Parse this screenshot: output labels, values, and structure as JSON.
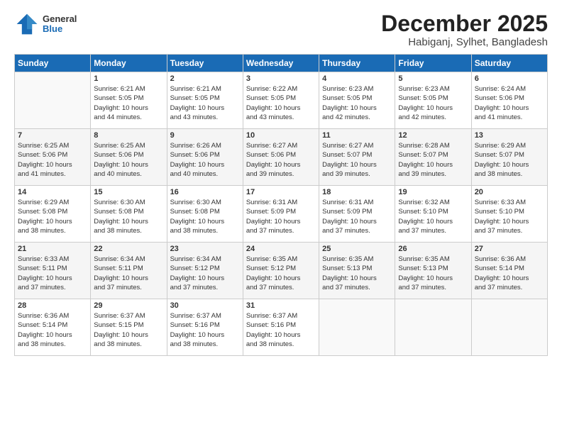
{
  "header": {
    "logo_general": "General",
    "logo_blue": "Blue",
    "month": "December 2025",
    "location": "Habiganj, Sylhet, Bangladesh"
  },
  "weekdays": [
    "Sunday",
    "Monday",
    "Tuesday",
    "Wednesday",
    "Thursday",
    "Friday",
    "Saturday"
  ],
  "weeks": [
    [
      {
        "day": "",
        "content": ""
      },
      {
        "day": "1",
        "content": "Sunrise: 6:21 AM\nSunset: 5:05 PM\nDaylight: 10 hours\nand 44 minutes."
      },
      {
        "day": "2",
        "content": "Sunrise: 6:21 AM\nSunset: 5:05 PM\nDaylight: 10 hours\nand 43 minutes."
      },
      {
        "day": "3",
        "content": "Sunrise: 6:22 AM\nSunset: 5:05 PM\nDaylight: 10 hours\nand 43 minutes."
      },
      {
        "day": "4",
        "content": "Sunrise: 6:23 AM\nSunset: 5:05 PM\nDaylight: 10 hours\nand 42 minutes."
      },
      {
        "day": "5",
        "content": "Sunrise: 6:23 AM\nSunset: 5:05 PM\nDaylight: 10 hours\nand 42 minutes."
      },
      {
        "day": "6",
        "content": "Sunrise: 6:24 AM\nSunset: 5:06 PM\nDaylight: 10 hours\nand 41 minutes."
      }
    ],
    [
      {
        "day": "7",
        "content": "Sunrise: 6:25 AM\nSunset: 5:06 PM\nDaylight: 10 hours\nand 41 minutes."
      },
      {
        "day": "8",
        "content": "Sunrise: 6:25 AM\nSunset: 5:06 PM\nDaylight: 10 hours\nand 40 minutes."
      },
      {
        "day": "9",
        "content": "Sunrise: 6:26 AM\nSunset: 5:06 PM\nDaylight: 10 hours\nand 40 minutes."
      },
      {
        "day": "10",
        "content": "Sunrise: 6:27 AM\nSunset: 5:06 PM\nDaylight: 10 hours\nand 39 minutes."
      },
      {
        "day": "11",
        "content": "Sunrise: 6:27 AM\nSunset: 5:07 PM\nDaylight: 10 hours\nand 39 minutes."
      },
      {
        "day": "12",
        "content": "Sunrise: 6:28 AM\nSunset: 5:07 PM\nDaylight: 10 hours\nand 39 minutes."
      },
      {
        "day": "13",
        "content": "Sunrise: 6:29 AM\nSunset: 5:07 PM\nDaylight: 10 hours\nand 38 minutes."
      }
    ],
    [
      {
        "day": "14",
        "content": "Sunrise: 6:29 AM\nSunset: 5:08 PM\nDaylight: 10 hours\nand 38 minutes."
      },
      {
        "day": "15",
        "content": "Sunrise: 6:30 AM\nSunset: 5:08 PM\nDaylight: 10 hours\nand 38 minutes."
      },
      {
        "day": "16",
        "content": "Sunrise: 6:30 AM\nSunset: 5:08 PM\nDaylight: 10 hours\nand 38 minutes."
      },
      {
        "day": "17",
        "content": "Sunrise: 6:31 AM\nSunset: 5:09 PM\nDaylight: 10 hours\nand 37 minutes."
      },
      {
        "day": "18",
        "content": "Sunrise: 6:31 AM\nSunset: 5:09 PM\nDaylight: 10 hours\nand 37 minutes."
      },
      {
        "day": "19",
        "content": "Sunrise: 6:32 AM\nSunset: 5:10 PM\nDaylight: 10 hours\nand 37 minutes."
      },
      {
        "day": "20",
        "content": "Sunrise: 6:33 AM\nSunset: 5:10 PM\nDaylight: 10 hours\nand 37 minutes."
      }
    ],
    [
      {
        "day": "21",
        "content": "Sunrise: 6:33 AM\nSunset: 5:11 PM\nDaylight: 10 hours\nand 37 minutes."
      },
      {
        "day": "22",
        "content": "Sunrise: 6:34 AM\nSunset: 5:11 PM\nDaylight: 10 hours\nand 37 minutes."
      },
      {
        "day": "23",
        "content": "Sunrise: 6:34 AM\nSunset: 5:12 PM\nDaylight: 10 hours\nand 37 minutes."
      },
      {
        "day": "24",
        "content": "Sunrise: 6:35 AM\nSunset: 5:12 PM\nDaylight: 10 hours\nand 37 minutes."
      },
      {
        "day": "25",
        "content": "Sunrise: 6:35 AM\nSunset: 5:13 PM\nDaylight: 10 hours\nand 37 minutes."
      },
      {
        "day": "26",
        "content": "Sunrise: 6:35 AM\nSunset: 5:13 PM\nDaylight: 10 hours\nand 37 minutes."
      },
      {
        "day": "27",
        "content": "Sunrise: 6:36 AM\nSunset: 5:14 PM\nDaylight: 10 hours\nand 37 minutes."
      }
    ],
    [
      {
        "day": "28",
        "content": "Sunrise: 6:36 AM\nSunset: 5:14 PM\nDaylight: 10 hours\nand 38 minutes."
      },
      {
        "day": "29",
        "content": "Sunrise: 6:37 AM\nSunset: 5:15 PM\nDaylight: 10 hours\nand 38 minutes."
      },
      {
        "day": "30",
        "content": "Sunrise: 6:37 AM\nSunset: 5:16 PM\nDaylight: 10 hours\nand 38 minutes."
      },
      {
        "day": "31",
        "content": "Sunrise: 6:37 AM\nSunset: 5:16 PM\nDaylight: 10 hours\nand 38 minutes."
      },
      {
        "day": "",
        "content": ""
      },
      {
        "day": "",
        "content": ""
      },
      {
        "day": "",
        "content": ""
      }
    ]
  ]
}
